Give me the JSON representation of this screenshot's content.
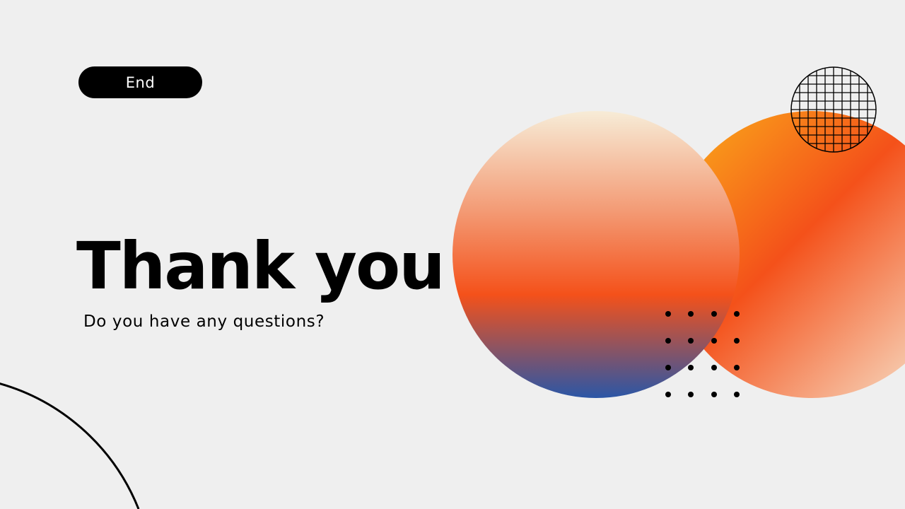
{
  "slide": {
    "badge_label": "End",
    "title": "Thank you",
    "subtitle": "Do you have any questions?"
  },
  "colors": {
    "background": "#efefef",
    "text": "#000000",
    "badge_bg": "#000000",
    "badge_text": "#ffffff",
    "gradient_cream": "#f7ecd7",
    "gradient_orange": "#f4511a",
    "gradient_amber": "#f7941d",
    "gradient_blue": "#2b56a6"
  },
  "decorations": {
    "grid_circle_icon": "grid-circle",
    "dot_matrix": {
      "rows": 4,
      "cols": 4
    }
  }
}
